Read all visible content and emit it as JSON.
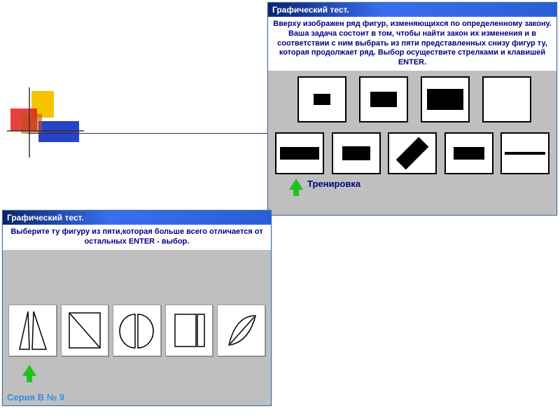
{
  "window1": {
    "title": "Графический тест.",
    "instruction": "Вверху изображен ряд фигур, изменяющихся по определенному закону. Ваша задача состоит в том, чтобы найти закон их изменения и в соответствии с ним выбрать из пяти представленных снизу фигур ту, которая продолжает ряд.\nВыбор осуществите стрелками и клавишей ENTER.",
    "training_label": "Тренировка"
  },
  "window2": {
    "title": "Графический тест.",
    "instruction": "Выберите ту фигуру из пяти,которая больше всего отличается от остальных ENTER - выбор.",
    "series_label": "Серия В № 9"
  }
}
